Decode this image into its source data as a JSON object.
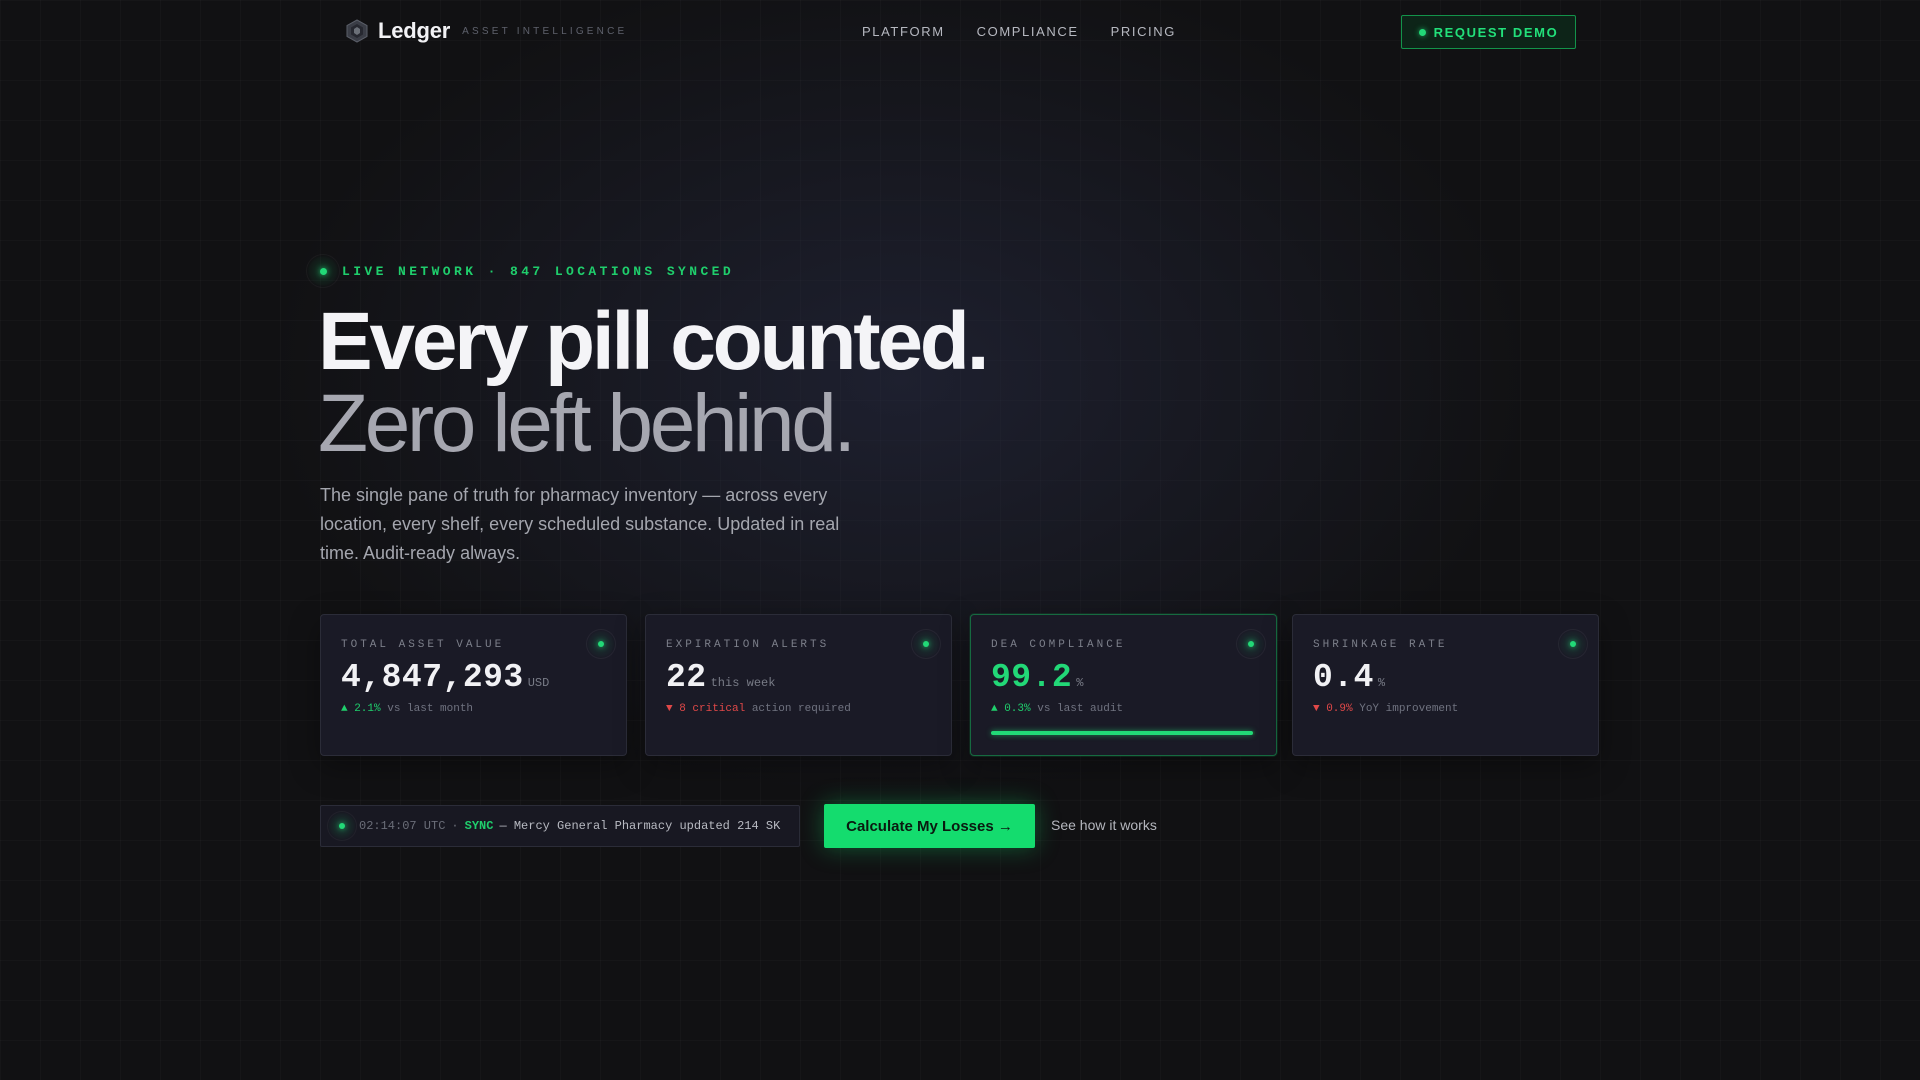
{
  "nav": {
    "logo_name": "Ledger",
    "logo_tag": "ASSET INTELLIGENCE",
    "logo_icon": "hexagon-logo-icon",
    "links": [
      "PLATFORM",
      "COMPLIANCE",
      "PRICING"
    ],
    "demo_label": "REQUEST DEMO"
  },
  "hero": {
    "live_status": "LIVE NETWORK · 847 LOCATIONS SYNCED",
    "headline": "Every pill counted.",
    "subheadline": "Zero left behind.",
    "description": "The single pane of truth for pharmacy inventory — across every location, every shelf, every scheduled substance. Updated in real time. Audit-ready always."
  },
  "cards": [
    {
      "label": "TOTAL ASSET VALUE",
      "value": "4,847,293",
      "unit": "USD",
      "delta": "▲ 2.1%",
      "delta_note": "vs last month",
      "trend": "up"
    },
    {
      "label": "EXPIRATION ALERTS",
      "value": "22",
      "unit": "this week",
      "delta": "▼ 8 critical",
      "delta_note": "action required",
      "trend": "down"
    },
    {
      "label": "DEA COMPLIANCE",
      "value": "99.2",
      "unit": "%",
      "delta": "▲ 0.3%",
      "delta_note": "vs last audit",
      "trend": "up",
      "progress": 0.992
    },
    {
      "label": "SHRINKAGE RATE",
      "value": "0.4",
      "unit": "%",
      "delta": "▼ 0.9%",
      "delta_note": "YoY improvement",
      "trend": "down"
    }
  ],
  "ticker": {
    "time": "02:14:07 UTC",
    "separator": "·",
    "tag": "SYNC",
    "message": "— Mercy General Pharmacy updated 214 SK"
  },
  "actions": {
    "cta_label": "Calculate My Losses →",
    "secondary_label": "See how it works"
  },
  "colors": {
    "accent": "#22d877",
    "negative": "#e04848",
    "background": "#111113",
    "card": "#1a1a26"
  }
}
